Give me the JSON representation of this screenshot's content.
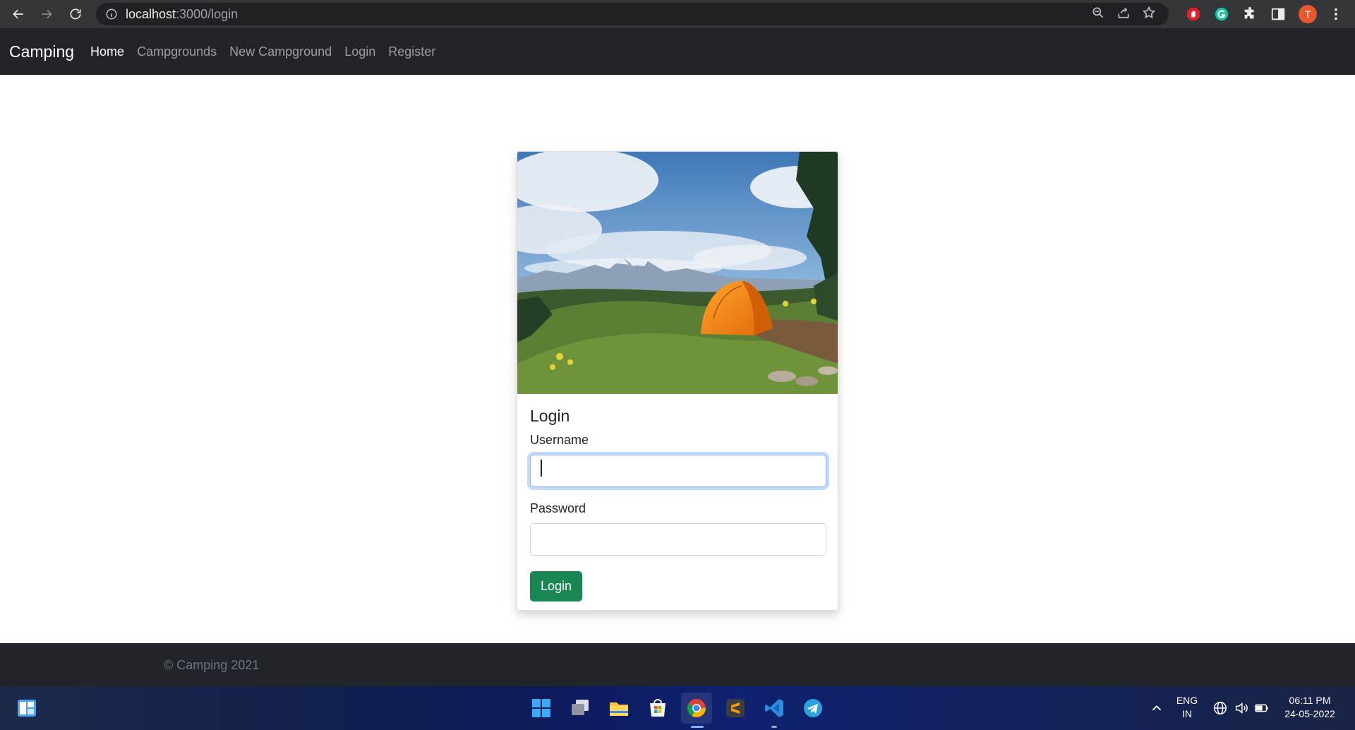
{
  "browser": {
    "url_host": "localhost",
    "url_path": ":3000/login",
    "profile_initial": "T"
  },
  "navbar": {
    "brand": "Camping",
    "links": [
      {
        "label": "Home",
        "active": true
      },
      {
        "label": "Campgrounds",
        "active": false
      },
      {
        "label": "New Campground",
        "active": false
      },
      {
        "label": "Login",
        "active": false
      },
      {
        "label": "Register",
        "active": false
      }
    ]
  },
  "login_card": {
    "title": "Login",
    "username_label": "Username",
    "username_value": "",
    "password_label": "Password",
    "password_value": "",
    "submit_label": "Login",
    "image_alt": "Orange tent on grassy hill with mountains"
  },
  "footer": {
    "copyright": "© Camping 2021"
  },
  "taskbar": {
    "language_line1": "ENG",
    "language_line2": "IN",
    "time": "06:11 PM",
    "date": "24-05-2022"
  },
  "colors": {
    "navbar_bg": "#212529",
    "button_success": "#198754",
    "focus_border": "#86b7fe"
  }
}
